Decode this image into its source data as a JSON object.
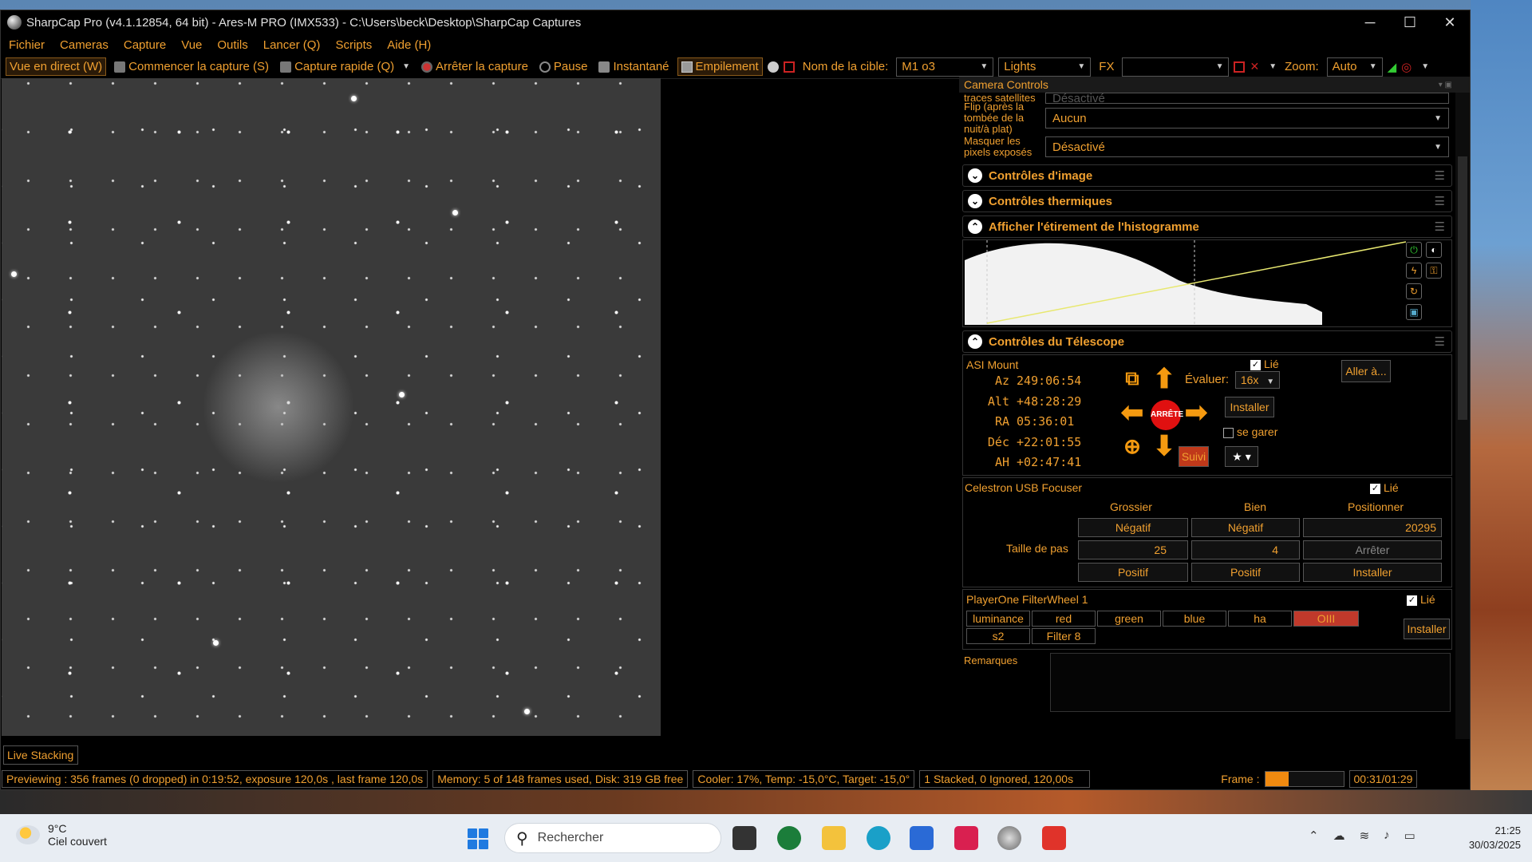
{
  "window": {
    "title": "SharpCap Pro (v4.1.12854, 64 bit) - Ares-M PRO (IMX533) - C:\\Users\\beck\\Desktop\\SharpCap Captures",
    "minimize": "─",
    "maximize": "☐",
    "close": "✕"
  },
  "menu": [
    "Fichier",
    "Cameras",
    "Capture",
    "Vue",
    "Outils",
    "Lancer (Q)",
    "Scripts",
    "Aide (H)"
  ],
  "toolbar": {
    "live_view": "Vue en direct (W)",
    "start_capture": "Commencer la capture (S)",
    "quick_capture": "Capture rapide (Q)",
    "stop_capture": "Arrêter la capture",
    "pause": "Pause",
    "snapshot": "Instantané",
    "stacking": "Empilement",
    "target_label": "Nom de la cible:",
    "target_value": "M1 o3",
    "frame_type": "Lights",
    "fx_label": "FX",
    "fx_value": "",
    "zoom_label": "Zoom:",
    "zoom_value": "Auto"
  },
  "camera_controls": {
    "header": "Camera Controls",
    "rows": [
      {
        "label": "traces satellites",
        "value": "Désactivé"
      },
      {
        "label": "Flip (après la tombée de la nuit/à plat)",
        "value": "Aucun"
      },
      {
        "label": "Masquer les pixels exposés",
        "value": "Désactivé"
      }
    ],
    "sections": {
      "image": "Contrôles d'image",
      "thermal": "Contrôles thermiques",
      "histogram": "Afficher l'étirement de l'histogramme",
      "telescope": "Contrôles du Télescope"
    }
  },
  "telescope": {
    "mount_name": "ASI Mount",
    "linked_label": "Lié",
    "coords": [
      {
        "label": "Az",
        "value": "249:06:54"
      },
      {
        "label": "Alt",
        "value": "+48:28:29"
      },
      {
        "label": "RA",
        "value": "05:36:01"
      },
      {
        "label": "Déc",
        "value": "+22:01:55"
      },
      {
        "label": "AH",
        "value": "+02:47:41"
      }
    ],
    "stop": "ARRÊTE",
    "rate_label": "Évaluer:",
    "rate_value": "16x",
    "setup": "Installer",
    "park": "se garer",
    "tracking": "Suivi",
    "goto": "Aller à..."
  },
  "focuser": {
    "name": "Celestron USB Focuser",
    "linked_label": "Lié",
    "col_coarse": "Grossier",
    "col_fine": "Bien",
    "col_position": "Positionner",
    "negative": "Négatif",
    "positive": "Positif",
    "step_label": "Taille de pas",
    "coarse_step": "25",
    "fine_step": "4",
    "position": "20295",
    "stop": "Arrêter",
    "setup": "Installer"
  },
  "filterwheel": {
    "name": "PlayerOne FilterWheel 1",
    "linked_label": "Lié",
    "filters": [
      "luminance",
      "red",
      "green",
      "blue",
      "ha",
      "OIII",
      "s2",
      "Filter 8"
    ],
    "active": "OIII",
    "setup": "Installer"
  },
  "remarks_label": "Remarques",
  "live_stacking": "Live Stacking",
  "status": {
    "preview": "Previewing : 356 frames (0 dropped) in 0:19:52, exposure 120,0s , last frame 120,0s",
    "memory": "Memory: 5 of 148 frames used, Disk: 319 GB free",
    "cooler": "Cooler: 17%, Temp: -15,0°C, Target: -15,0°",
    "stacked": "1 Stacked, 0 Ignored, 120,00s",
    "frame_label": "Frame :",
    "frame_progress": 0.3,
    "time": "00:31/01:29"
  },
  "taskbar": {
    "temp": "9°C",
    "weather": "Ciel couvert",
    "search": "Rechercher",
    "time": "21:25",
    "date": "30/03/2025"
  },
  "colors": {
    "accent": "#f0a030",
    "active_filter": "#c0392b",
    "stop_red": "#e01010"
  }
}
